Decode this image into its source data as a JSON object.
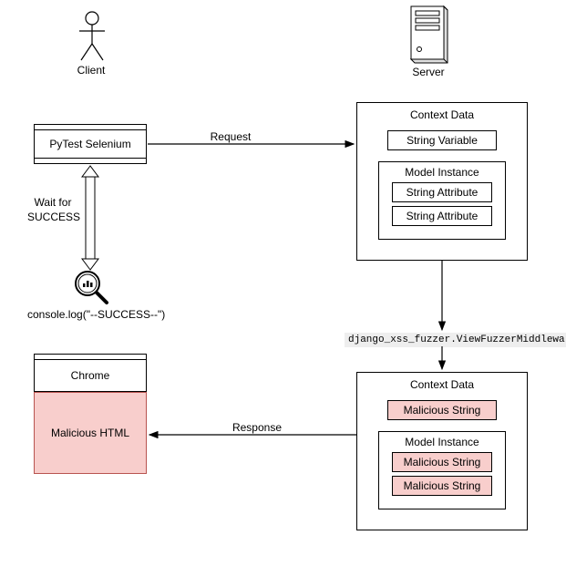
{
  "actors": {
    "client": "Client",
    "server": "Server"
  },
  "client_side": {
    "pytest": "PyTest Selenium",
    "wait_label": "Wait for\nSUCCESS",
    "console_log": "console.log(\"--SUCCESS--\")",
    "chrome": "Chrome",
    "malicious_html": "Malicious HTML"
  },
  "arrows": {
    "request": "Request",
    "response": "Response"
  },
  "middleware": "django_xss_fuzzer.ViewFuzzerMiddleware",
  "context_before": {
    "title": "Context Data",
    "string_var": "String Variable",
    "model": {
      "title": "Model Instance",
      "attrs": [
        "String Attribute",
        "String Attribute"
      ]
    }
  },
  "context_after": {
    "title": "Context Data",
    "malicious_top": "Malicious String",
    "model": {
      "title": "Model Instance",
      "attrs": [
        "Malicious String",
        "Malicious String"
      ]
    }
  },
  "icons": {
    "client_actor": "person-icon",
    "server": "server-icon",
    "magnify": "magnify-chart-icon"
  }
}
